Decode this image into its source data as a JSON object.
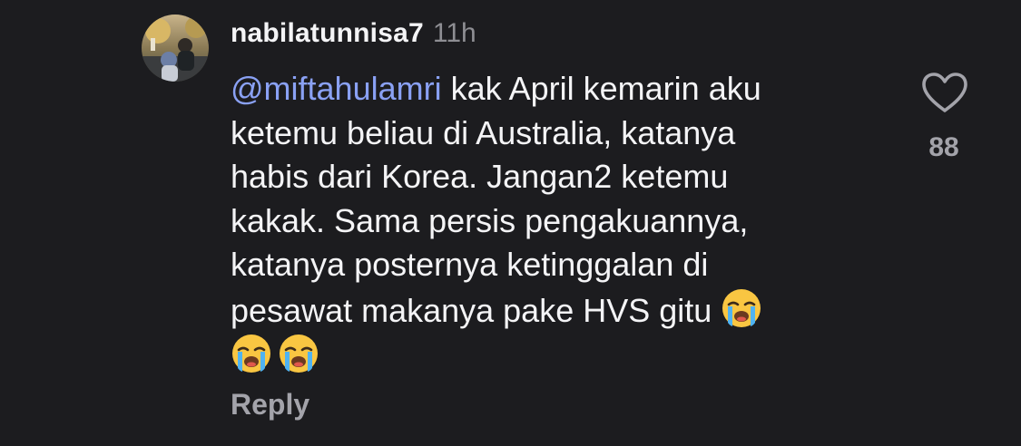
{
  "comment": {
    "username": "nabilatunnisa7",
    "timestamp": "11h",
    "mention": "@miftahulamri",
    "lines": [
      " kak April kemarin aku",
      "ketemu beliau di Australia, katanya",
      "habis dari Korea. Jangan2 ketemu",
      "kakak. Sama persis pengakuannya,",
      "katanya posternya ketinggalan di",
      "pesawat makanya pake HVS gitu "
    ],
    "reply_label": "Reply",
    "like_count": "88"
  },
  "icons": {
    "like": "heart-outline-icon",
    "emoji": "loudly-crying-face-emoji"
  },
  "colors": {
    "background": "#1c1c1f",
    "text": "#f4f4f6",
    "mention": "#8aa1f4",
    "muted": "#8e8e93"
  }
}
